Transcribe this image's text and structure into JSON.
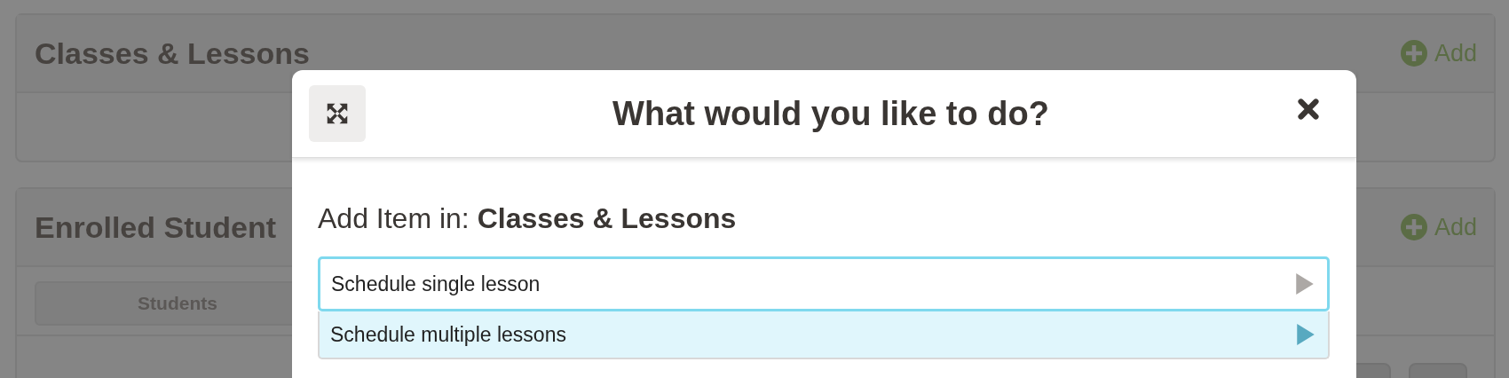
{
  "page": {
    "sections": [
      {
        "title": "Classes & Lessons",
        "add_label": "Add"
      },
      {
        "title": "Enrolled Student",
        "add_label": "Add",
        "tabs": [
          {
            "label": "Students"
          }
        ]
      }
    ]
  },
  "dialog": {
    "title": "What would you like to do?",
    "prompt": "Add Item in: **Classes & Lessons**",
    "options": [
      {
        "label": "Schedule single lesson",
        "focused": true,
        "selected": false
      },
      {
        "label": "Schedule multiple lessons",
        "focused": false,
        "selected": true
      }
    ]
  }
}
